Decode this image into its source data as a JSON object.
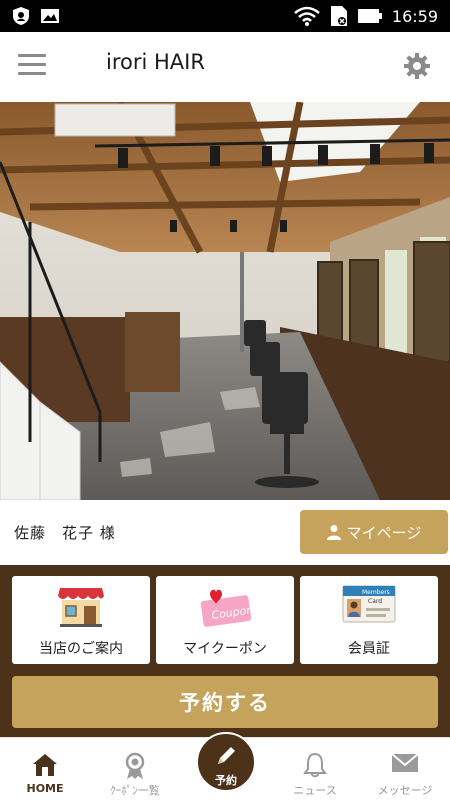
{
  "status_bar": {
    "time": "16:59",
    "icons": [
      "shield-icon",
      "image-icon",
      "wifi-icon",
      "sim-icon",
      "battery-icon"
    ]
  },
  "header": {
    "title": "irori HAIR",
    "menu_icon": "hamburger-menu-icon",
    "settings_icon": "gear-icon"
  },
  "hero": {
    "description_icon": "salon-interior-photo"
  },
  "user": {
    "name": "佐藤　花子 様",
    "mypage_label": "マイページ",
    "mypage_icon": "person-icon"
  },
  "tiles": [
    {
      "label": "当店のご案内",
      "icon": "shop-icon"
    },
    {
      "label": "マイクーポン",
      "icon": "coupon-icon"
    },
    {
      "label": "会員証",
      "icon": "members-card-icon"
    }
  ],
  "reserve": {
    "label": "予約する"
  },
  "bottom_nav": {
    "items": [
      {
        "label": "HOME",
        "icon": "home-icon"
      },
      {
        "label": "ｸｰﾎﾟﾝ一覧",
        "icon": "coupon-list-icon"
      },
      {
        "label": "予約",
        "icon": "pen-icon"
      },
      {
        "label": "ニュース",
        "icon": "bell-icon"
      },
      {
        "label": "メッセージ",
        "icon": "mail-icon"
      }
    ]
  },
  "colors": {
    "brand_brown": "#4b3219",
    "accent_gold": "#c6a35c"
  }
}
